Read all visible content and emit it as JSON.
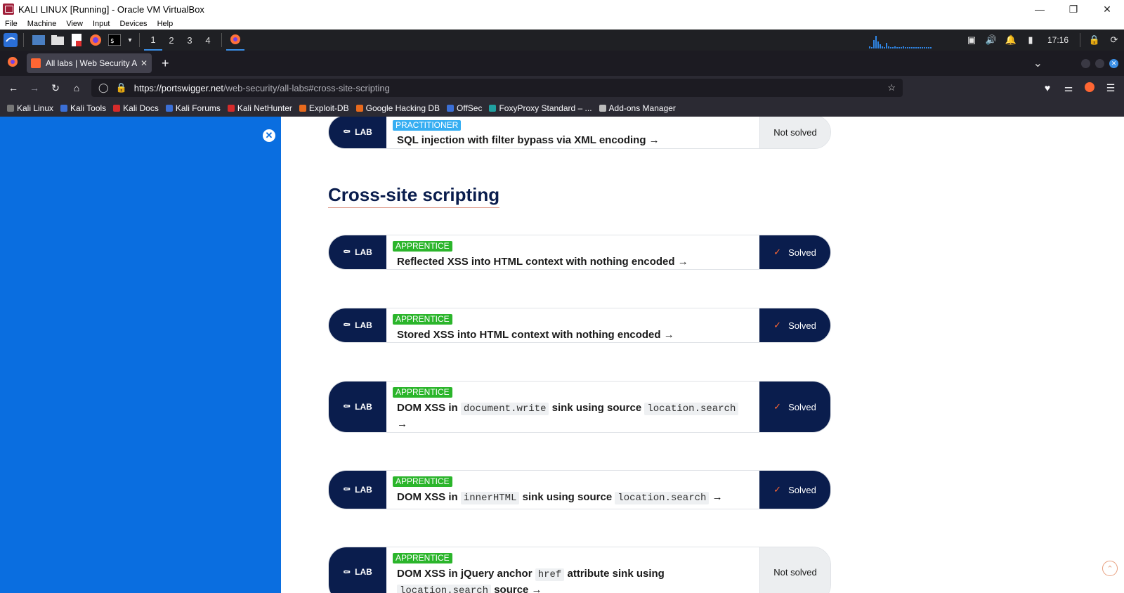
{
  "vbox": {
    "title": "KALI LINUX [Running] - Oracle VM VirtualBox",
    "menu": [
      "File",
      "Machine",
      "View",
      "Input",
      "Devices",
      "Help"
    ]
  },
  "panel": {
    "workspaces": [
      "1",
      "2",
      "3",
      "4"
    ],
    "clock": "17:16"
  },
  "firefox": {
    "tab_title": "All labs | Web Security Ac",
    "url_host": "https://portswigger.net",
    "url_path": "/web-security/all-labs#cross-site-scripting",
    "bookmarks": [
      "Kali Linux",
      "Kali Tools",
      "Kali Docs",
      "Kali Forums",
      "Kali NetHunter",
      "Exploit-DB",
      "Google Hacking DB",
      "OffSec",
      "FoxyProxy Standard – ...",
      "Add-ons Manager"
    ]
  },
  "page": {
    "section_title": "Cross-site scripting",
    "lab_label": "LAB",
    "labs": [
      {
        "level": "PRACTITIONER",
        "title": "SQL injection with filter bypass via XML encoding →",
        "status": "Not solved"
      },
      {
        "level": "APPRENTICE",
        "title": "Reflected XSS into HTML context with nothing encoded →",
        "status": "Solved"
      },
      {
        "level": "APPRENTICE",
        "title": "Stored XSS into HTML context with nothing encoded →",
        "status": "Solved"
      },
      {
        "level": "APPRENTICE",
        "t1": "DOM XSS in",
        "c1": "document.write",
        "t2": "sink using source",
        "c2": "location.search",
        "t3": "→",
        "status": "Solved"
      },
      {
        "level": "APPRENTICE",
        "t1": "DOM XSS in",
        "c1": "innerHTML",
        "t2": "sink using source",
        "c2": "location.search",
        "t3": "→",
        "status": "Solved"
      },
      {
        "level": "APPRENTICE",
        "t1": "DOM XSS in jQuery anchor",
        "c1": "href",
        "t2": "attribute sink using",
        "c2": "location.search",
        "t3": "source →",
        "status": "Not solved"
      }
    ]
  }
}
